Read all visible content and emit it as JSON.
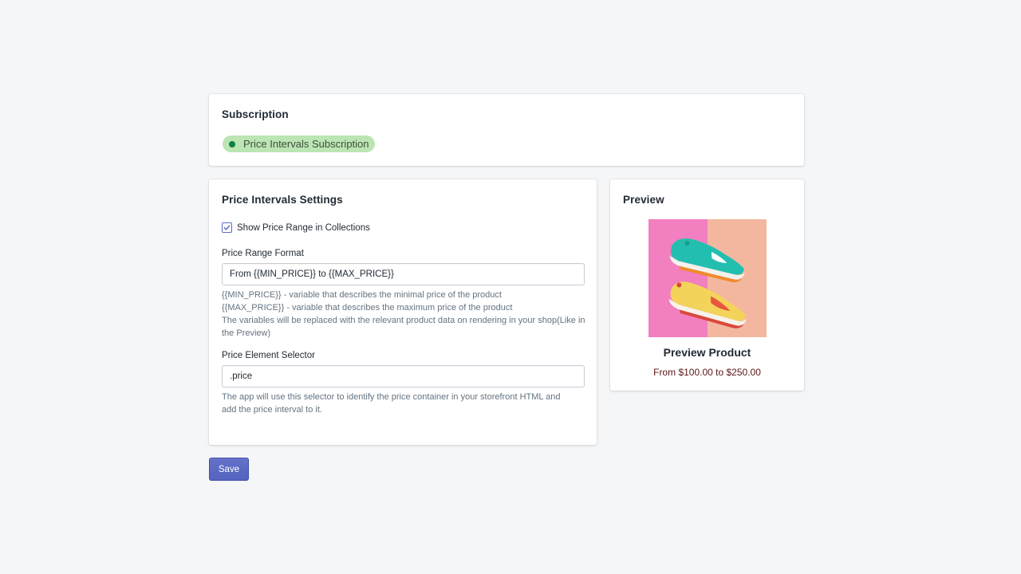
{
  "subscription": {
    "title": "Subscription",
    "badge_label": "Price Intervals Subscription",
    "badge_color": "#bbe5b3",
    "badge_dot_color": "#108043"
  },
  "settings": {
    "title": "Price Intervals Settings",
    "show_range_label": "Show Price Range in Collections",
    "show_range_checked": true,
    "format_label": "Price Range Format",
    "format_value": "From {{MIN_PRICE}} to {{MAX_PRICE}}",
    "format_help": [
      "{{MIN_PRICE}} - variable that describes the minimal price of the product",
      "{{MAX_PRICE}} - variable that describes the maximum price of the product",
      "The variables will be replaced with the relevant product data on rendering in your shop(Like in the Preview)"
    ],
    "selector_label": "Price Element Selector",
    "selector_value": ".price",
    "selector_help": "The app will use this selector to identify the price container in your storefront HTML and add the price interval to it."
  },
  "preview": {
    "title": "Preview",
    "product_name": "Preview Product",
    "product_price": "From $100.00 to $250.00"
  },
  "actions": {
    "save_label": "Save",
    "primary_color": "#5c6ac4"
  }
}
